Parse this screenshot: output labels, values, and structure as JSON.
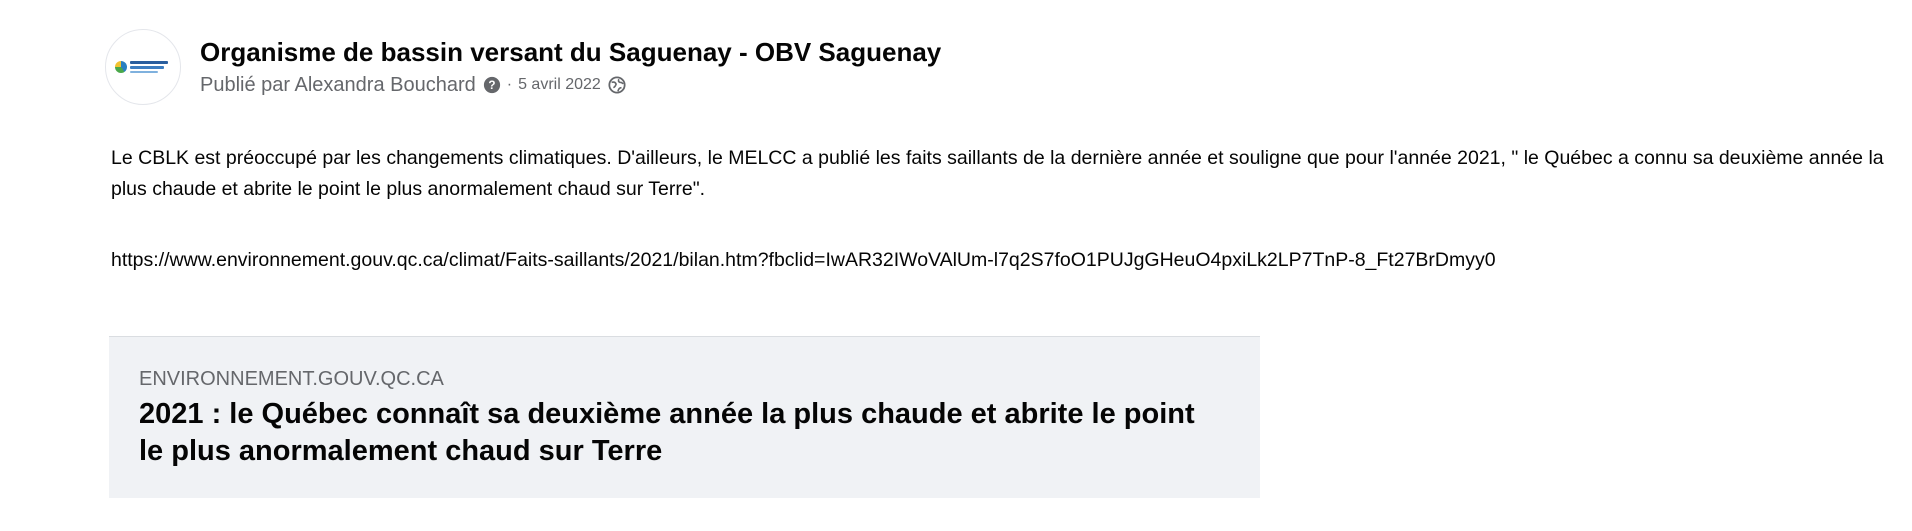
{
  "post": {
    "page_name": "Organisme de bassin versant du Saguenay - OBV Saguenay",
    "published_by": "Publié par Alexandra Bouchard",
    "separator": "·",
    "date": "5 avril 2022",
    "help_icon": "help-circle-icon",
    "audience_icon": "globe-icon",
    "text": "Le CBLK est préoccupé par les changements climatiques. D'ailleurs, le MELCC a publié les faits saillants de la dernière année et souligne que pour l'année 2021, \" le Québec a connu sa deuxième année la plus chaude et abrite le point le plus anormalement chaud sur Terre\".",
    "link_text": "https://www.environnement.gouv.qc.ca/climat/Faits-saillants/2021/bilan.htm?fbclid=IwAR32IWoVAlUm-l7q2S7foO1PUJgGHeuO4pxiLk2LP7TnP-8_Ft27BrDmyy0"
  },
  "link_preview": {
    "domain": "ENVIRONNEMENT.GOUV.QC.CA",
    "title": "2021 : le Québec connaît sa deuxième année la plus chaude et abrite le point le plus anormalement chaud sur Terre"
  },
  "colors": {
    "text_primary": "#050505",
    "text_secondary": "#65676b",
    "card_background": "#f0f2f5"
  }
}
